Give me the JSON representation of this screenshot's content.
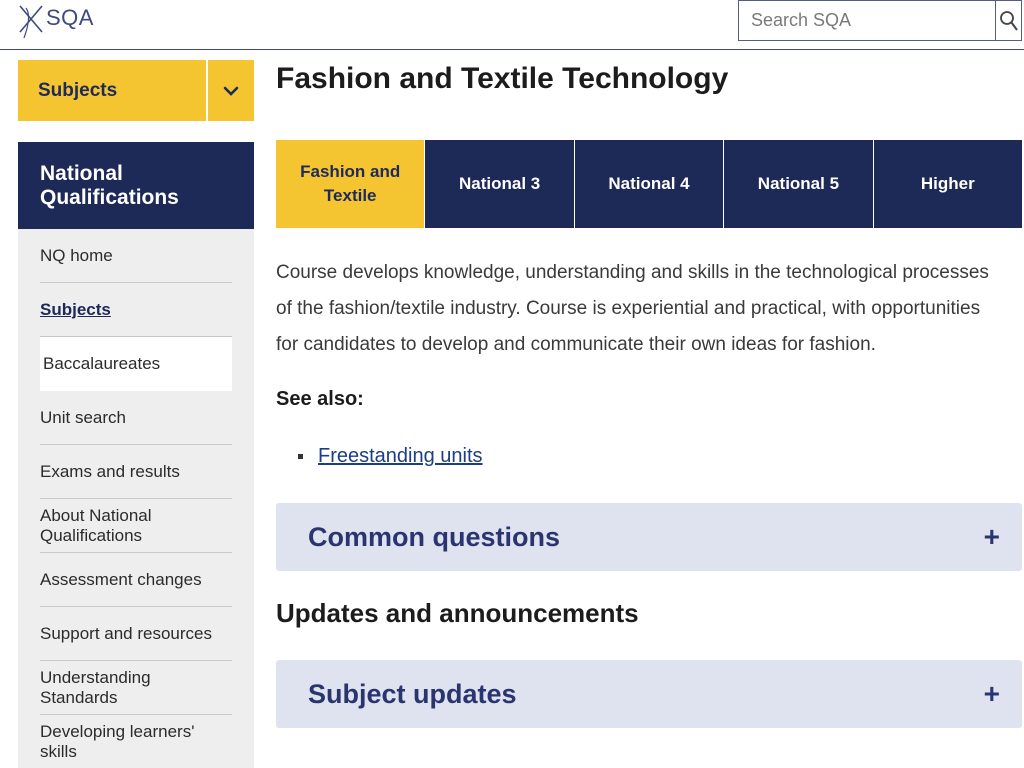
{
  "header": {
    "logo_text": "SQA",
    "search": {
      "placeholder": "Search SQA",
      "value": ""
    },
    "search_icon": "magnifier-icon"
  },
  "sidebar": {
    "dropdown": {
      "label": "Subjects",
      "icon": "chevron-down-icon"
    },
    "section_title": "National Qualifications",
    "items": [
      {
        "label": "NQ home"
      },
      {
        "label": "Subjects",
        "state": "active"
      },
      {
        "label": "Baccalaureates",
        "state": "highlight"
      },
      {
        "label": "Unit search"
      },
      {
        "label": "Exams and results"
      },
      {
        "label": "About National Qualifications"
      },
      {
        "label": "Assessment changes"
      },
      {
        "label": "Support and resources"
      },
      {
        "label": "Understanding Standards"
      },
      {
        "label": "Developing learners' skills"
      }
    ]
  },
  "main": {
    "title": "Fashion and Textile Technology",
    "tabs": [
      {
        "label": "Fashion and Textile",
        "active": true
      },
      {
        "label": "National 3"
      },
      {
        "label": "National 4"
      },
      {
        "label": "National 5"
      },
      {
        "label": "Higher"
      }
    ],
    "description": "Course develops knowledge, understanding and skills in the technological processes of the fashion/textile industry. Course is experiential and practical, with opportunities for candidates to develop and communicate their own ideas for fashion.",
    "see_also_heading": "See also:",
    "see_also_links": [
      {
        "label": "Freestanding units"
      }
    ],
    "accordion_common": {
      "label": "Common questions",
      "toggle": "+"
    },
    "updates_heading": "Updates and announcements",
    "accordion_updates": {
      "label": "Subject updates",
      "toggle": "+"
    }
  },
  "colors": {
    "navy": "#1d2956",
    "yellow": "#f5c431",
    "accordion_bg": "#dfe2ef",
    "link": "#1d3d86"
  }
}
